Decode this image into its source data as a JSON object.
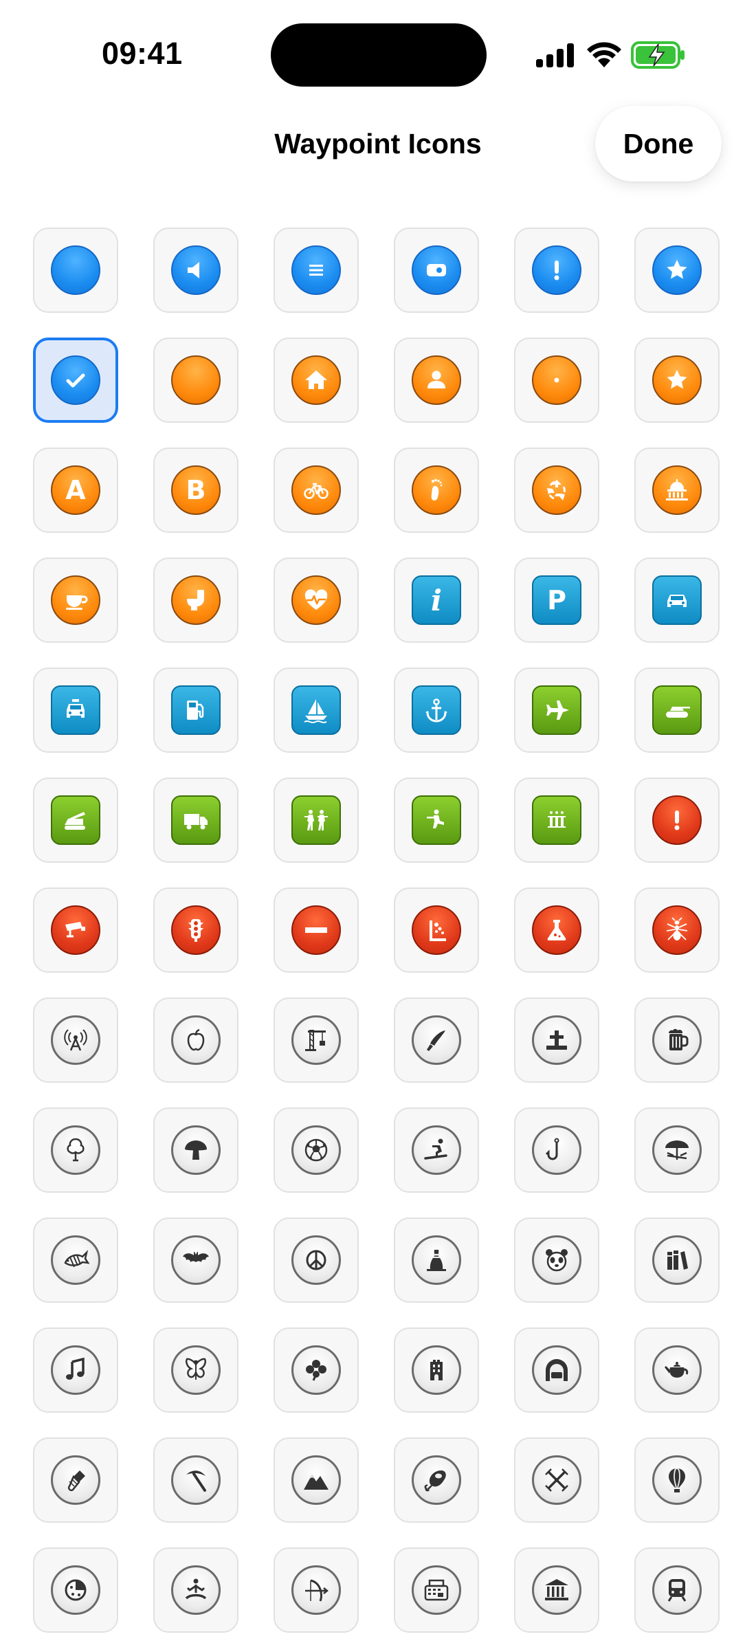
{
  "status_bar": {
    "time": "09:41"
  },
  "nav": {
    "title": "Waypoint Icons",
    "done_label": "Done"
  },
  "rows": [
    [
      {
        "name": "blue-dot-icon",
        "color": "blue",
        "shape": "circle",
        "icon": "none"
      },
      {
        "name": "blue-speaker-icon",
        "color": "blue",
        "shape": "circle",
        "icon": "speaker"
      },
      {
        "name": "blue-list-icon",
        "color": "blue",
        "shape": "circle",
        "icon": "list"
      },
      {
        "name": "blue-camera-icon",
        "color": "blue",
        "shape": "circle",
        "icon": "camera"
      },
      {
        "name": "blue-exclamation-icon",
        "color": "blue",
        "shape": "circle",
        "icon": "exclamation"
      },
      {
        "name": "blue-star-icon",
        "color": "blue",
        "shape": "circle",
        "icon": "star"
      }
    ],
    [
      {
        "name": "blue-checkmark-icon",
        "color": "blue",
        "shape": "circle",
        "icon": "check",
        "selected": true
      },
      {
        "name": "orange-dot-icon",
        "color": "orange",
        "shape": "circle",
        "icon": "none"
      },
      {
        "name": "orange-house-icon",
        "color": "orange",
        "shape": "circle",
        "icon": "house"
      },
      {
        "name": "orange-person-icon",
        "color": "orange",
        "shape": "circle",
        "icon": "person"
      },
      {
        "name": "orange-center-dot-icon",
        "color": "orange",
        "shape": "circle",
        "icon": "dot"
      },
      {
        "name": "orange-star-icon",
        "color": "orange",
        "shape": "circle",
        "icon": "star"
      }
    ],
    [
      {
        "name": "orange-letter-a-icon",
        "color": "orange",
        "shape": "circle",
        "icon": "letter",
        "letter": "A"
      },
      {
        "name": "orange-letter-b-icon",
        "color": "orange",
        "shape": "circle",
        "icon": "letter",
        "letter": "B"
      },
      {
        "name": "orange-bicycle-icon",
        "color": "orange",
        "shape": "circle",
        "icon": "bicycle"
      },
      {
        "name": "orange-footprint-icon",
        "color": "orange",
        "shape": "circle",
        "icon": "footprint"
      },
      {
        "name": "orange-recycle-icon",
        "color": "orange",
        "shape": "circle",
        "icon": "recycle"
      },
      {
        "name": "orange-capitol-icon",
        "color": "orange",
        "shape": "circle",
        "icon": "capitol"
      }
    ],
    [
      {
        "name": "orange-cup-icon",
        "color": "orange",
        "shape": "circle",
        "icon": "cup"
      },
      {
        "name": "orange-toilet-icon",
        "color": "orange",
        "shape": "circle",
        "icon": "toilet"
      },
      {
        "name": "orange-heart-pulse-icon",
        "color": "orange",
        "shape": "circle",
        "icon": "heart"
      },
      {
        "name": "teal-info-icon",
        "color": "teal",
        "shape": "rounded",
        "icon": "info",
        "letter": "i"
      },
      {
        "name": "teal-parking-icon",
        "color": "teal",
        "shape": "rounded",
        "icon": "letter",
        "letter": "P"
      },
      {
        "name": "teal-car-icon",
        "color": "teal",
        "shape": "rounded",
        "icon": "car"
      }
    ],
    [
      {
        "name": "teal-taxi-icon",
        "color": "teal",
        "shape": "rounded",
        "icon": "taxi"
      },
      {
        "name": "teal-fuel-icon",
        "color": "teal",
        "shape": "rounded",
        "icon": "fuel"
      },
      {
        "name": "teal-sailboat-icon",
        "color": "teal",
        "shape": "rounded",
        "icon": "sailboat"
      },
      {
        "name": "teal-anchor-icon",
        "color": "teal",
        "shape": "rounded",
        "icon": "anchor"
      },
      {
        "name": "green-fighter-jet-icon",
        "color": "green",
        "shape": "rounded",
        "icon": "jet"
      },
      {
        "name": "green-tank-icon",
        "color": "green",
        "shape": "rounded",
        "icon": "tank"
      }
    ],
    [
      {
        "name": "green-rocket-launcher-icon",
        "color": "green",
        "shape": "rounded",
        "icon": "launcher"
      },
      {
        "name": "green-truck-icon",
        "color": "green",
        "shape": "rounded",
        "icon": "truck"
      },
      {
        "name": "green-soldiers-icon",
        "color": "green",
        "shape": "rounded",
        "icon": "soldiers"
      },
      {
        "name": "green-soldier-kneeling-icon",
        "color": "green",
        "shape": "rounded",
        "icon": "kneel"
      },
      {
        "name": "green-rank-bars-icon",
        "color": "green",
        "shape": "rounded",
        "icon": "rank"
      },
      {
        "name": "red-exclamation-icon",
        "color": "red",
        "shape": "circle",
        "icon": "exclamation"
      }
    ],
    [
      {
        "name": "red-cctv-camera-icon",
        "color": "red",
        "shape": "circle",
        "icon": "cctv"
      },
      {
        "name": "red-traffic-light-icon",
        "color": "red",
        "shape": "circle",
        "icon": "traffic"
      },
      {
        "name": "red-no-entry-icon",
        "color": "red",
        "shape": "circle",
        "icon": "noentry"
      },
      {
        "name": "red-falling-rocks-icon",
        "color": "red",
        "shape": "circle",
        "icon": "rocks"
      },
      {
        "name": "red-flask-icon",
        "color": "red",
        "shape": "circle",
        "icon": "flask"
      },
      {
        "name": "red-ant-icon",
        "color": "red",
        "shape": "circle",
        "icon": "ant"
      }
    ],
    [
      {
        "name": "gray-antenna-icon",
        "color": "gray",
        "shape": "circle",
        "icon": "antenna"
      },
      {
        "name": "gray-apple-icon",
        "color": "gray",
        "shape": "circle",
        "icon": "apple"
      },
      {
        "name": "gray-crane-icon",
        "color": "gray",
        "shape": "circle",
        "icon": "crane"
      },
      {
        "name": "gray-knife-icon",
        "color": "gray",
        "shape": "circle",
        "icon": "knife"
      },
      {
        "name": "gray-grave-icon",
        "color": "gray",
        "shape": "circle",
        "icon": "grave"
      },
      {
        "name": "gray-beer-mug-icon",
        "color": "gray",
        "shape": "circle",
        "icon": "beer"
      }
    ],
    [
      {
        "name": "gray-tree-icon",
        "color": "gray",
        "shape": "circle",
        "icon": "tree"
      },
      {
        "name": "gray-mushroom-icon",
        "color": "gray",
        "shape": "circle",
        "icon": "mushroom"
      },
      {
        "name": "gray-soccer-ball-icon",
        "color": "gray",
        "shape": "circle",
        "icon": "soccer"
      },
      {
        "name": "gray-snowboarder-icon",
        "color": "gray",
        "shape": "circle",
        "icon": "snowboard"
      },
      {
        "name": "gray-fish-hook-icon",
        "color": "gray",
        "shape": "circle",
        "icon": "hook"
      },
      {
        "name": "gray-beach-umbrella-icon",
        "color": "gray",
        "shape": "circle",
        "icon": "umbrella"
      }
    ],
    [
      {
        "name": "gray-fish-icon",
        "color": "gray",
        "shape": "circle",
        "icon": "fish"
      },
      {
        "name": "gray-bat-icon",
        "color": "gray",
        "shape": "circle",
        "icon": "bat"
      },
      {
        "name": "gray-peace-icon",
        "color": "gray",
        "shape": "circle",
        "icon": "peace"
      },
      {
        "name": "gray-bowling-pin-icon",
        "color": "gray",
        "shape": "circle",
        "icon": "pin"
      },
      {
        "name": "gray-panda-icon",
        "color": "gray",
        "shape": "circle",
        "icon": "panda"
      },
      {
        "name": "gray-books-icon",
        "color": "gray",
        "shape": "circle",
        "icon": "books"
      }
    ],
    [
      {
        "name": "gray-music-note-icon",
        "color": "gray",
        "shape": "circle",
        "icon": "music"
      },
      {
        "name": "gray-butterfly-icon",
        "color": "gray",
        "shape": "circle",
        "icon": "butterfly"
      },
      {
        "name": "gray-clover-icon",
        "color": "gray",
        "shape": "circle",
        "icon": "clover"
      },
      {
        "name": "gray-tower-icon",
        "color": "gray",
        "shape": "circle",
        "icon": "tower"
      },
      {
        "name": "gray-tunnel-icon",
        "color": "gray",
        "shape": "circle",
        "icon": "tunnel"
      },
      {
        "name": "gray-teapot-icon",
        "color": "gray",
        "shape": "circle",
        "icon": "teapot"
      }
    ],
    [
      {
        "name": "gray-shuttlecock-icon",
        "color": "gray",
        "shape": "circle",
        "icon": "shuttle"
      },
      {
        "name": "gray-pickaxe-icon",
        "color": "gray",
        "shape": "circle",
        "icon": "pickaxe"
      },
      {
        "name": "gray-mountains-icon",
        "color": "gray",
        "shape": "circle",
        "icon": "mountain"
      },
      {
        "name": "gray-ham-icon",
        "color": "gray",
        "shape": "circle",
        "icon": "ham"
      },
      {
        "name": "gray-crossed-tools-icon",
        "color": "gray",
        "shape": "circle",
        "icon": "crossed"
      },
      {
        "name": "gray-hot-air-balloon-icon",
        "color": "gray",
        "shape": "circle",
        "icon": "balloon"
      }
    ],
    [
      {
        "name": "gray-pizza-icon",
        "color": "gray",
        "shape": "circle",
        "icon": "pizza"
      },
      {
        "name": "gray-meditation-icon",
        "color": "gray",
        "shape": "circle",
        "icon": "yoga"
      },
      {
        "name": "gray-bow-arrow-icon",
        "color": "gray",
        "shape": "circle",
        "icon": "bow"
      },
      {
        "name": "gray-cash-register-icon",
        "color": "gray",
        "shape": "circle",
        "icon": "register"
      },
      {
        "name": "gray-museum-icon",
        "color": "gray",
        "shape": "circle",
        "icon": "museum"
      },
      {
        "name": "gray-train-icon",
        "color": "gray",
        "shape": "circle",
        "icon": "train"
      }
    ]
  ]
}
